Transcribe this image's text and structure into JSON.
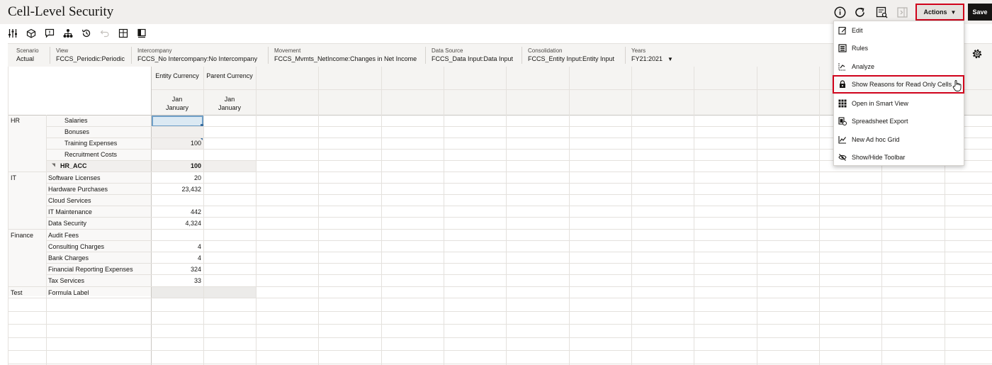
{
  "header": {
    "title": "Cell-Level Security",
    "actions_label": "Actions",
    "save_label": "Save"
  },
  "pov": [
    {
      "label": "Scenario",
      "value": "Actual"
    },
    {
      "label": "View",
      "value": "FCCS_Periodic:Periodic"
    },
    {
      "label": "Intercompany",
      "value": "FCCS_No Intercompany:No Intercompany"
    },
    {
      "label": "Movement",
      "value": "FCCS_Mvmts_NetIncome:Changes in Net Income"
    },
    {
      "label": "Data Source",
      "value": "FCCS_Data Input:Data Input"
    },
    {
      "label": "Consolidation",
      "value": "FCCS_Entity Input:Entity Input"
    },
    {
      "label": "Years",
      "value": "FY21:2021"
    }
  ],
  "grid": {
    "columns": [
      {
        "header": "Entity Currency",
        "period_short": "Jan",
        "period_long": "January"
      },
      {
        "header": "Parent Currency",
        "period_short": "Jan",
        "period_long": "January"
      }
    ],
    "rows": [
      {
        "group": "HR",
        "account": "Salaries",
        "entity": "",
        "parent": ""
      },
      {
        "group": "",
        "account": "Bonuses",
        "entity": "",
        "parent": ""
      },
      {
        "group": "",
        "account": "Training Expenses",
        "entity": "100",
        "parent": ""
      },
      {
        "group": "",
        "account": "Recruitment Costs",
        "entity": "",
        "parent": ""
      },
      {
        "group": "",
        "account": "HR_ACC",
        "entity": "100",
        "parent": ""
      },
      {
        "group": "IT",
        "account": "Software Licenses",
        "entity": "20",
        "parent": ""
      },
      {
        "group": "",
        "account": "Hardware Purchases",
        "entity": "23,432",
        "parent": ""
      },
      {
        "group": "",
        "account": "Cloud Services",
        "entity": "",
        "parent": ""
      },
      {
        "group": "",
        "account": "IT Maintenance",
        "entity": "442",
        "parent": ""
      },
      {
        "group": "",
        "account": "Data Security",
        "entity": "4,324",
        "parent": ""
      },
      {
        "group": "Finance",
        "account": "Audit Fees",
        "entity": "",
        "parent": ""
      },
      {
        "group": "",
        "account": "Consulting Charges",
        "entity": "4",
        "parent": ""
      },
      {
        "group": "",
        "account": "Bank Charges",
        "entity": "4",
        "parent": ""
      },
      {
        "group": "",
        "account": "Financial Reporting Expenses",
        "entity": "324",
        "parent": ""
      },
      {
        "group": "",
        "account": "Tax Services",
        "entity": "33",
        "parent": ""
      },
      {
        "group": "Test",
        "account": "Formula Label",
        "entity": "",
        "parent": ""
      }
    ]
  },
  "actions_menu": [
    {
      "label": "Edit",
      "icon": "edit-icon"
    },
    {
      "label": "Rules",
      "icon": "rules-icon"
    },
    {
      "label": "Analyze",
      "icon": "analyze-icon"
    },
    {
      "label": "Show Reasons for Read Only Cells",
      "icon": "lock-reasons-icon"
    },
    {
      "label": "Open in Smart View",
      "icon": "smart-view-icon"
    },
    {
      "label": "Spreadsheet Export",
      "icon": "spreadsheet-export-icon"
    },
    {
      "label": "New Ad hoc Grid",
      "icon": "adhoc-grid-icon"
    },
    {
      "label": "Show/Hide Toolbar",
      "icon": "hide-toolbar-icon"
    }
  ],
  "colors": {
    "highlight_border": "#d0021b",
    "header_bg": "#f1efed",
    "selected_cell": "#dbe9f3",
    "readonly_cell": "#f1efed"
  }
}
